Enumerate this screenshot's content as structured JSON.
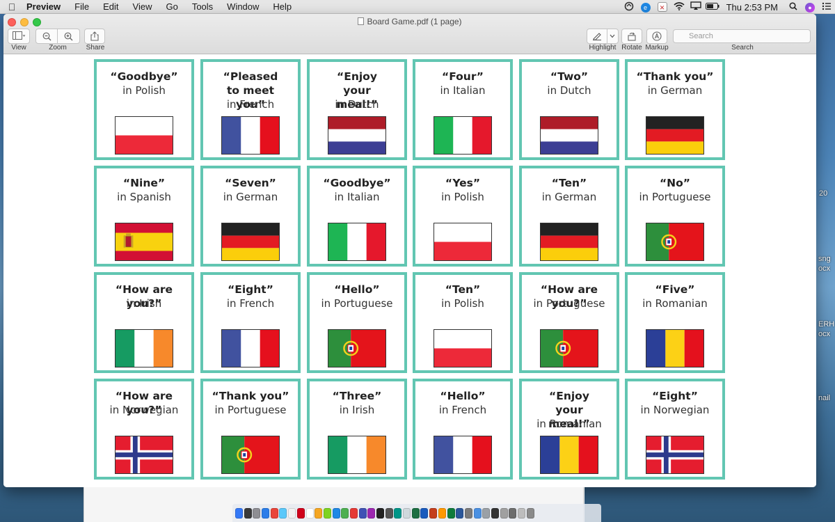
{
  "menubar": {
    "app_name": "Preview",
    "menus": [
      "File",
      "Edit",
      "View",
      "Go",
      "Tools",
      "Window",
      "Help"
    ],
    "clock": "Thu 2:53 PM",
    "status_icons": [
      "sync-icon",
      "e-badge-icon",
      "x-badge-icon",
      "wifi-icon",
      "airplay-icon",
      "battery-icon",
      "clock",
      "spotlight-icon",
      "siri-icon",
      "notification-center-icon"
    ]
  },
  "window": {
    "title": "Board Game.pdf (1 page)",
    "toolbar": {
      "view_label": "View",
      "zoom_label": "Zoom",
      "share_label": "Share",
      "highlight_label": "Highlight",
      "rotate_label": "Rotate",
      "markup_label": "Markup",
      "search_label": "Search",
      "search_placeholder": "Search"
    }
  },
  "desktop_fragments": [
    "20",
    "sng",
    "ocx",
    "ERH",
    "ocx",
    "nail"
  ],
  "colors": {
    "card_border": "#62c6b2"
  },
  "cards": [
    {
      "phrase": "“Goodbye”",
      "language": "in Polish",
      "flag": "poland"
    },
    {
      "phrase": "“Pleased to meet you”",
      "language": "in French",
      "flag": "france"
    },
    {
      "phrase": "“Enjoy your meal!”",
      "language": "in Dutch",
      "flag": "netherlands"
    },
    {
      "phrase": "“Four”",
      "language": "in Italian",
      "flag": "italy"
    },
    {
      "phrase": "“Two”",
      "language": "in Dutch",
      "flag": "netherlands"
    },
    {
      "phrase": "“Thank you”",
      "language": "in German",
      "flag": "germany"
    },
    {
      "phrase": "“Nine”",
      "language": "in Spanish",
      "flag": "spain"
    },
    {
      "phrase": "“Seven”",
      "language": "in German",
      "flag": "germany"
    },
    {
      "phrase": "“Goodbye”",
      "language": "in Italian",
      "flag": "italy"
    },
    {
      "phrase": "“Yes”",
      "language": "in Polish",
      "flag": "poland"
    },
    {
      "phrase": "“Ten”",
      "language": "in German",
      "flag": "germany"
    },
    {
      "phrase": "“No”",
      "language": "in Portuguese",
      "flag": "portugal"
    },
    {
      "phrase": "“How are you?”",
      "language": "in Irish",
      "flag": "ireland"
    },
    {
      "phrase": "“Eight”",
      "language": "in French",
      "flag": "france"
    },
    {
      "phrase": "“Hello”",
      "language": "in Portuguese",
      "flag": "portugal"
    },
    {
      "phrase": "“Ten”",
      "language": "in Polish",
      "flag": "poland"
    },
    {
      "phrase": "“How are you?”",
      "language": "in Portuguese",
      "flag": "portugal"
    },
    {
      "phrase": "“Five”",
      "language": "in Romanian",
      "flag": "romania"
    },
    {
      "phrase": "“How are you?”",
      "language": "in Norwegian",
      "flag": "norway"
    },
    {
      "phrase": "“Thank you”",
      "language": "in Portuguese",
      "flag": "portugal"
    },
    {
      "phrase": "“Three”",
      "language": "in Irish",
      "flag": "ireland"
    },
    {
      "phrase": "“Hello”",
      "language": "in French",
      "flag": "france"
    },
    {
      "phrase": "“Enjoy your meal!”",
      "language": "in Romanian",
      "flag": "romania"
    },
    {
      "phrase": "“Eight”",
      "language": "in Norwegian",
      "flag": "norway"
    }
  ],
  "dock_icon_colors": [
    "#3478f6",
    "#3a3a3a",
    "#8e8e93",
    "#2b7de9",
    "#e9453a",
    "#5ac8fa",
    "#f2f2f2",
    "#d0021b",
    "#ffffff",
    "#f5a623",
    "#7ed321",
    "#1e88e5",
    "#4caf50",
    "#e53935",
    "#3f51b5",
    "#9c27b0",
    "#222222",
    "#555555",
    "#009688",
    "#cfd8dc",
    "#1d6f42",
    "#185abd",
    "#c43e1c",
    "#ff9800",
    "#0f7b3b",
    "#2b579a",
    "#7b7b7b",
    "#4a90e2",
    "#9aa0a6",
    "#333333",
    "#a0a0a0",
    "#6d6d6d",
    "#bdbdbd",
    "#8a8a8a"
  ]
}
